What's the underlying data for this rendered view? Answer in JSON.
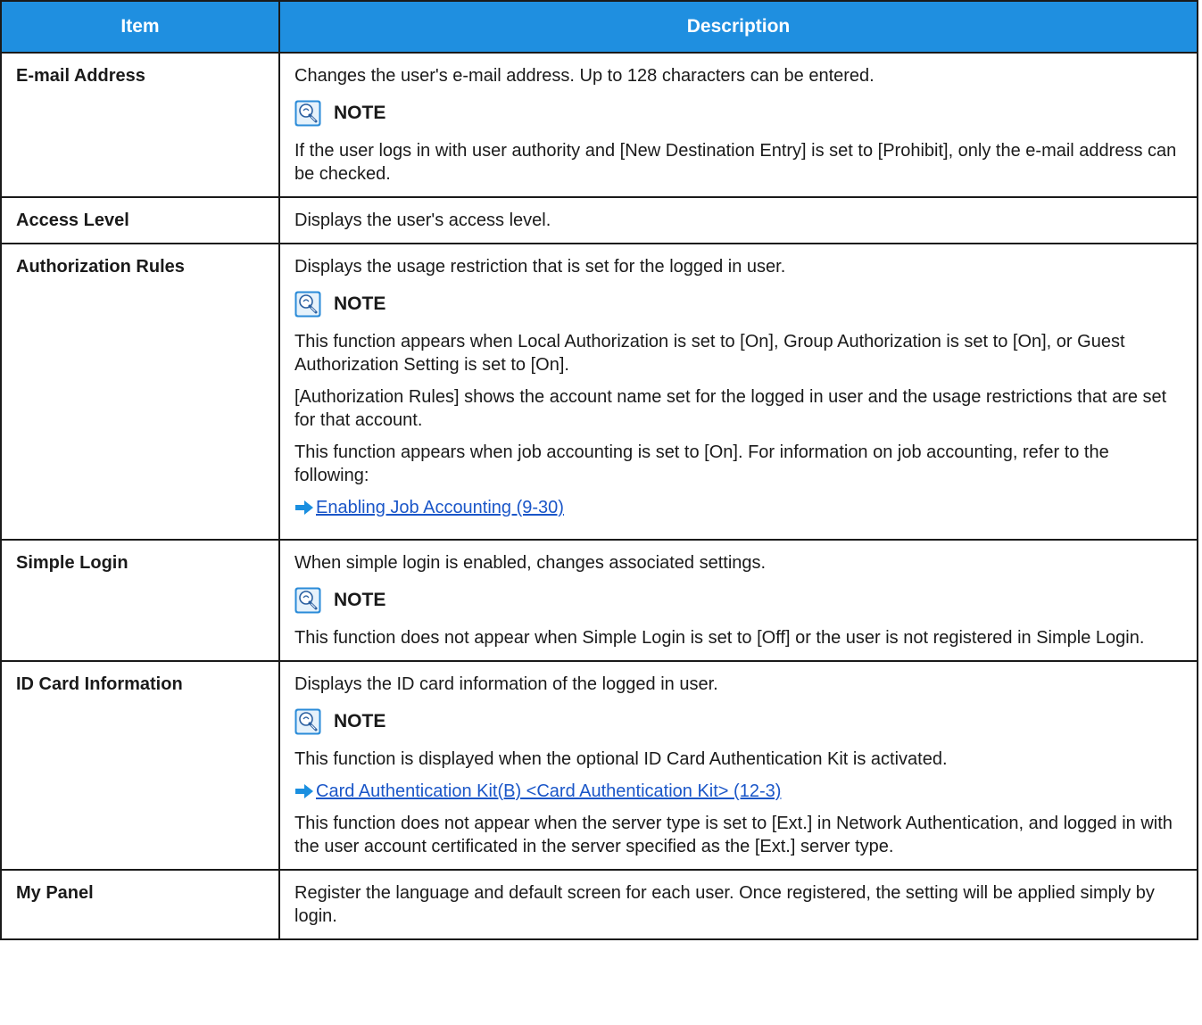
{
  "header": {
    "item": "Item",
    "description": "Description"
  },
  "note_label": "NOTE",
  "rows": {
    "email": {
      "item": "E-mail Address",
      "desc": "Changes the user's e-mail address. Up to 128 characters can be entered.",
      "note": "If the user logs in with user authority and [New Destination Entry] is set to [Prohibit], only the e-mail address can be checked."
    },
    "access": {
      "item": "Access Level",
      "desc": "Displays the user's access level."
    },
    "authorization": {
      "item": "Authorization Rules",
      "desc": "Displays the usage restriction that is set for the logged in user.",
      "note1": "This function appears when Local Authorization is set to [On], Group Authorization is set to [On], or Guest Authorization Setting is set to [On].",
      "note2": "[Authorization Rules] shows the account name set for the logged in user and the usage restrictions that are set for that account.",
      "note3": "This function appears when job accounting is set to [On]. For information on job accounting, refer to the following:",
      "link": "Enabling Job Accounting (9-30)"
    },
    "simple_login": {
      "item": "Simple Login",
      "desc": "When simple login is enabled, changes associated settings.",
      "note": "This function does not appear when Simple Login is set to [Off] or the user is not registered in Simple Login."
    },
    "id_card": {
      "item": "ID Card Information",
      "desc": "Displays the ID card information of the logged in user.",
      "note1": "This function is displayed when the optional ID Card Authentication Kit is activated.",
      "link": "Card Authentication Kit(B) <Card Authentication Kit> (12-3)",
      "note2": "This function does not appear when the server type is set to [Ext.] in Network Authentication, and logged in with the user account certificated in the server specified as the [Ext.] server type."
    },
    "my_panel": {
      "item": "My Panel",
      "desc": "Register the language and default screen for each user. Once registered, the setting will be applied simply by login."
    }
  },
  "colors": {
    "header_bg": "#1f8fe0",
    "link": "#1a56c8",
    "note_icon": "#2a8bd8"
  }
}
